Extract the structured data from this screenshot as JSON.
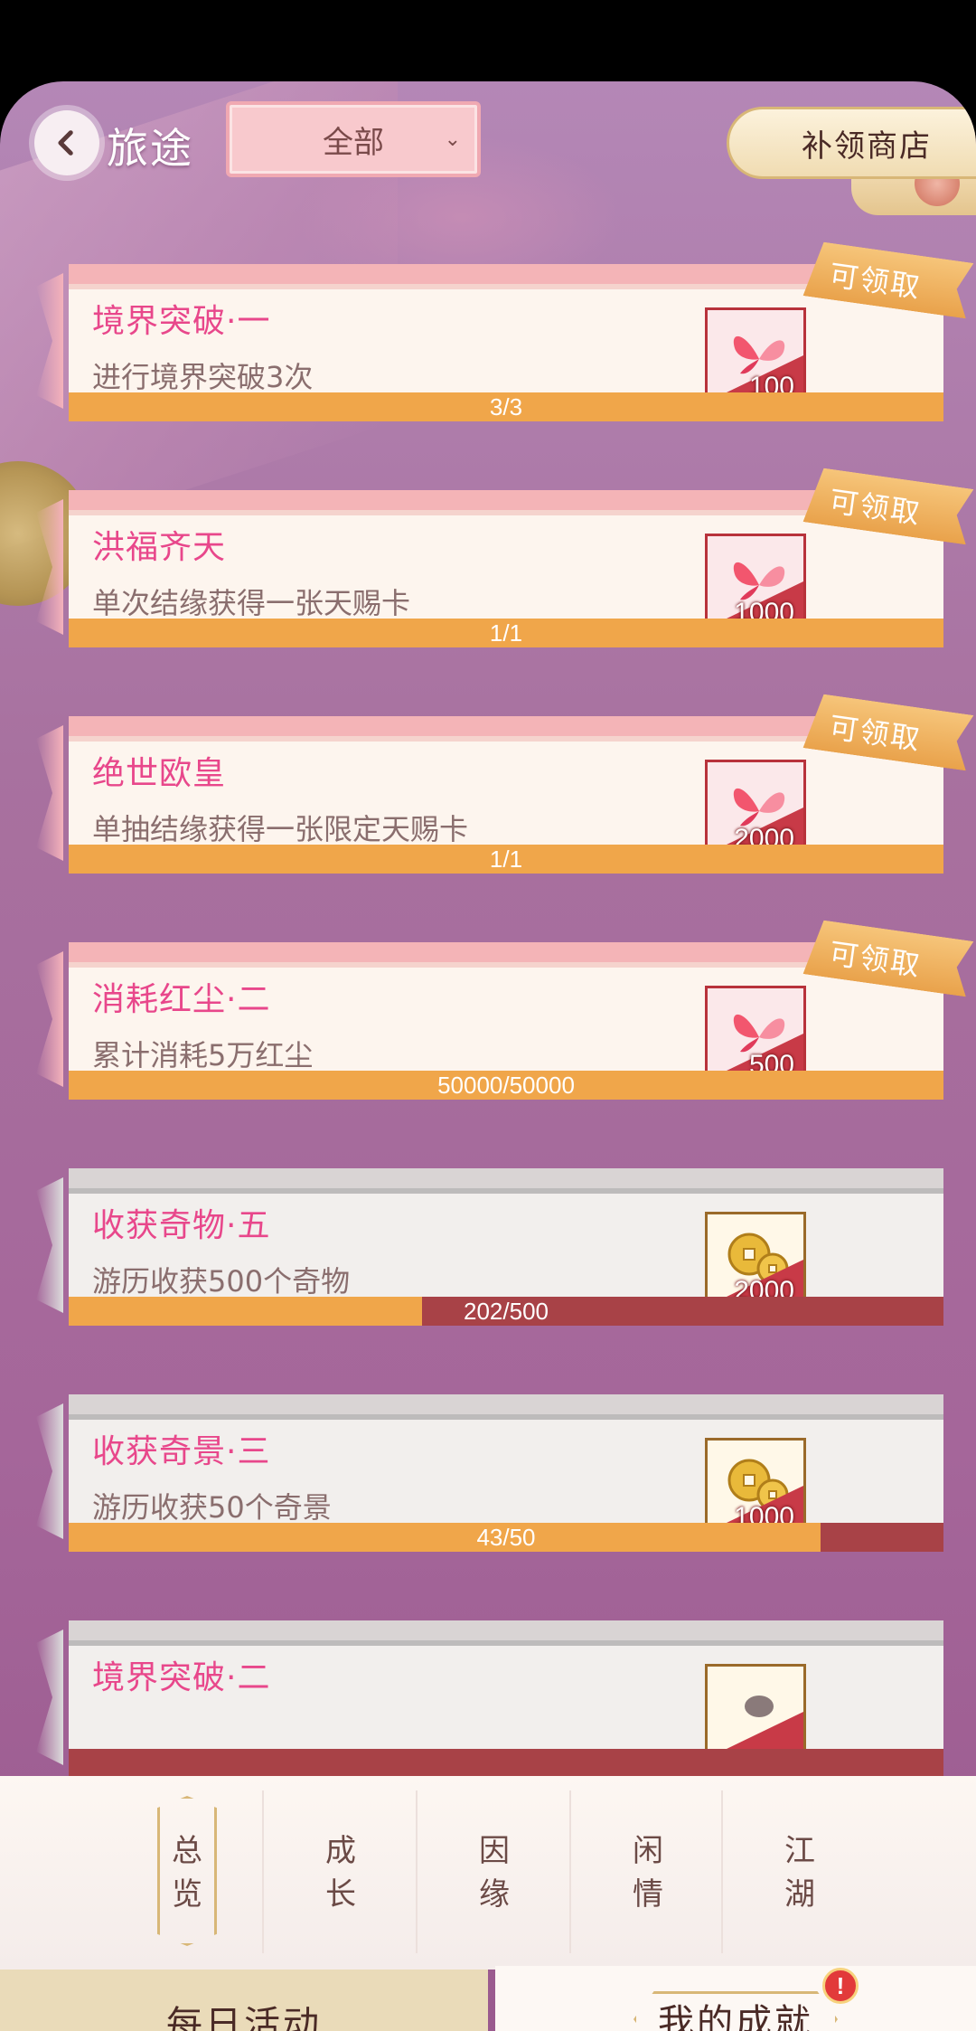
{
  "header": {
    "title": "旅途",
    "filter_value": "全部",
    "shop_label": "补领商店"
  },
  "claim_label": "可领取",
  "achievements": [
    {
      "name": "境界突破·一",
      "desc": "进行境界突破3次",
      "reward_amount": "100",
      "reward_icon": "butterfly-icon",
      "progress_text": "3/3",
      "progress": 1.0,
      "claimable": true
    },
    {
      "name": "洪福齐天",
      "desc": "单次结缘获得一张天赐卡",
      "reward_amount": "1000",
      "reward_icon": "butterfly-icon",
      "progress_text": "1/1",
      "progress": 1.0,
      "claimable": true
    },
    {
      "name": "绝世欧皇",
      "desc": "单抽结缘获得一张限定天赐卡",
      "reward_amount": "2000",
      "reward_icon": "butterfly-icon",
      "progress_text": "1/1",
      "progress": 1.0,
      "claimable": true
    },
    {
      "name": "消耗红尘·二",
      "desc": "累计消耗5万红尘",
      "reward_amount": "500",
      "reward_icon": "butterfly-icon",
      "progress_text": "50000/50000",
      "progress": 1.0,
      "claimable": true
    },
    {
      "name": "收获奇物·五",
      "desc": "游历收获500个奇物",
      "reward_amount": "2000",
      "reward_icon": "coins-icon",
      "progress_text": "202/500",
      "progress": 0.404,
      "claimable": false
    },
    {
      "name": "收获奇景·三",
      "desc": "游历收获50个奇景",
      "reward_amount": "1000",
      "reward_icon": "coins-icon",
      "progress_text": "43/50",
      "progress": 0.86,
      "claimable": false
    },
    {
      "name": "境界突破·二",
      "desc": "",
      "reward_amount": "",
      "reward_icon": "item-icon",
      "progress_text": "",
      "progress": 0,
      "claimable": false
    }
  ],
  "tabs": [
    {
      "label_top": "总",
      "label_bottom": "览",
      "active": true
    },
    {
      "label_top": "成",
      "label_bottom": "长",
      "active": false
    },
    {
      "label_top": "因",
      "label_bottom": "缘",
      "active": false
    },
    {
      "label_top": "闲",
      "label_bottom": "情",
      "active": false
    },
    {
      "label_top": "江",
      "label_bottom": "湖",
      "active": false
    }
  ],
  "bottom": {
    "daily_label": "每日活动",
    "mine_label": "我的成就",
    "alert_badge": "!"
  },
  "colors": {
    "accent_pink": "#e8478b",
    "progress_fill": "#f0a64a",
    "progress_track": "#a84247"
  }
}
